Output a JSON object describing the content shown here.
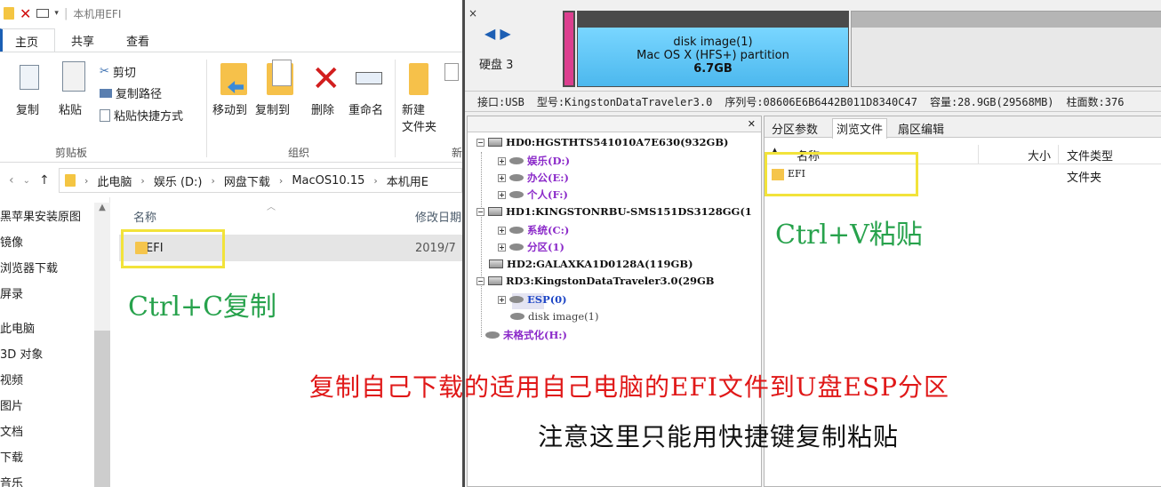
{
  "explorer": {
    "title": "本机用EFI",
    "tabs": [
      "主页",
      "共享",
      "查看"
    ],
    "ribbon": {
      "copy": "复制",
      "paste": "粘贴",
      "cut": "剪切",
      "copy_path": "复制路径",
      "paste_shortcut": "粘贴快捷方式",
      "move_to": "移动到",
      "copy_to": "复制到",
      "delete": "删除",
      "rename": "重命名",
      "new_folder_line1": "新建",
      "new_folder_line2": "文件夹",
      "group_clipboard": "剪贴板",
      "group_organize": "组织",
      "group_new_partial": "新"
    },
    "address": {
      "crumbs": [
        "此电脑",
        "娱乐 (D:)",
        "网盘下载",
        "MacOS10.15",
        "本机用E"
      ]
    },
    "nav_items": [
      "黑苹果安装原图",
      "镜像",
      "浏览器下载",
      "屏录",
      "此电脑",
      "3D 对象",
      "视频",
      "图片",
      "文档",
      "下载",
      "音乐"
    ],
    "columns": {
      "name": "名称",
      "modified": "修改日期"
    },
    "files": [
      {
        "name": "EFI",
        "date": "2019/7"
      }
    ]
  },
  "notes": {
    "ctrl_c": "Ctrl+C复制",
    "ctrl_v": "Ctrl+V粘贴",
    "caption_red": "复制自己下载的适用自己电脑的EFI文件到U盘ESP分区",
    "caption_black": "注意这里只能用快捷键复制粘贴"
  },
  "diskgenius": {
    "disk_label": "硬盘 3",
    "partition": {
      "name": "disk image(1)",
      "type": "Mac OS X (HFS+) partition",
      "size": "6.7GB"
    },
    "info_bar": {
      "interface": "接口:USB",
      "model": "型号:KingstonDataTraveler3.0",
      "serial": "序列号:08606E6B6442B011D8340C47",
      "capacity": "容量:28.9GB(29568MB)",
      "cylinders": "柱面数:376"
    },
    "tree": [
      {
        "text": "HD0:HGSTHTS541010A7E630(932GB)",
        "style": "bold",
        "level": 0
      },
      {
        "text": "娱乐(D:)",
        "style": "purple",
        "level": 1
      },
      {
        "text": "办公(E:)",
        "style": "purple",
        "level": 1
      },
      {
        "text": "个人(F:)",
        "style": "purple",
        "level": 1
      },
      {
        "text": "HD1:KINGSTONRBU-SMS151DS3128GG(1",
        "style": "bold",
        "level": 0
      },
      {
        "text": "系统(C:)",
        "style": "purple",
        "level": 1
      },
      {
        "text": "分区(1)",
        "style": "purple",
        "level": 1
      },
      {
        "text": "HD2:GALAXKA1D0128A(119GB)",
        "style": "bold",
        "level": 0
      },
      {
        "text": "RD3:KingstonDataTraveler3.0(29GB",
        "style": "bold",
        "level": 0
      },
      {
        "text": "ESP(0)",
        "style": "blue",
        "level": 1
      },
      {
        "text": "disk image(1)",
        "style": "gray",
        "level": 1
      },
      {
        "text": "未格式化(H:)",
        "style": "purple",
        "level": 0
      }
    ],
    "fb_tabs": [
      "分区参数",
      "浏览文件",
      "扇区编辑"
    ],
    "fb_columns": {
      "name": "名称",
      "size": "大小",
      "type": "文件类型"
    },
    "fb_files": [
      {
        "name": "EFI",
        "type": "文件夹"
      }
    ]
  }
}
